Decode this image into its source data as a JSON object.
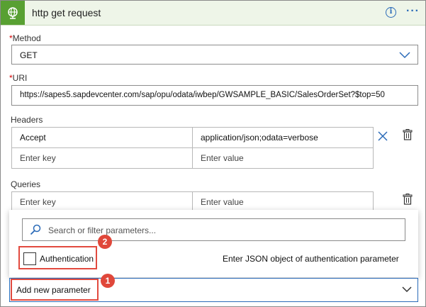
{
  "header": {
    "title": "http get request",
    "info_icon": "info-icon",
    "more_icon": "more-options-icon",
    "brand_color": "#58a032"
  },
  "method": {
    "label": "Method",
    "required_mark": "*",
    "value": "GET"
  },
  "uri": {
    "label": "URI",
    "required_mark": "*",
    "value": "https://sapes5.sapdevcenter.com/sap/opu/odata/iwbep/GWSAMPLE_BASIC/SalesOrderSet?$top=50"
  },
  "headers": {
    "label": "Headers",
    "rows": [
      {
        "key": "Accept",
        "value": "application/json;odata=verbose"
      },
      {
        "key": "Enter key",
        "value": "Enter value"
      }
    ]
  },
  "queries": {
    "label": "Queries",
    "rows": [
      {
        "key": "Enter key",
        "value": "Enter value"
      }
    ]
  },
  "param_popup": {
    "search_placeholder": "Search or filter parameters...",
    "authentication_label": "Authentication",
    "authentication_checked": false,
    "authentication_description": "Enter JSON object of authentication parameter"
  },
  "add_parameter": {
    "label": "Add new parameter"
  },
  "callouts": {
    "badge_1": "1",
    "badge_2": "2",
    "highlight_color": "#e24a3f"
  }
}
